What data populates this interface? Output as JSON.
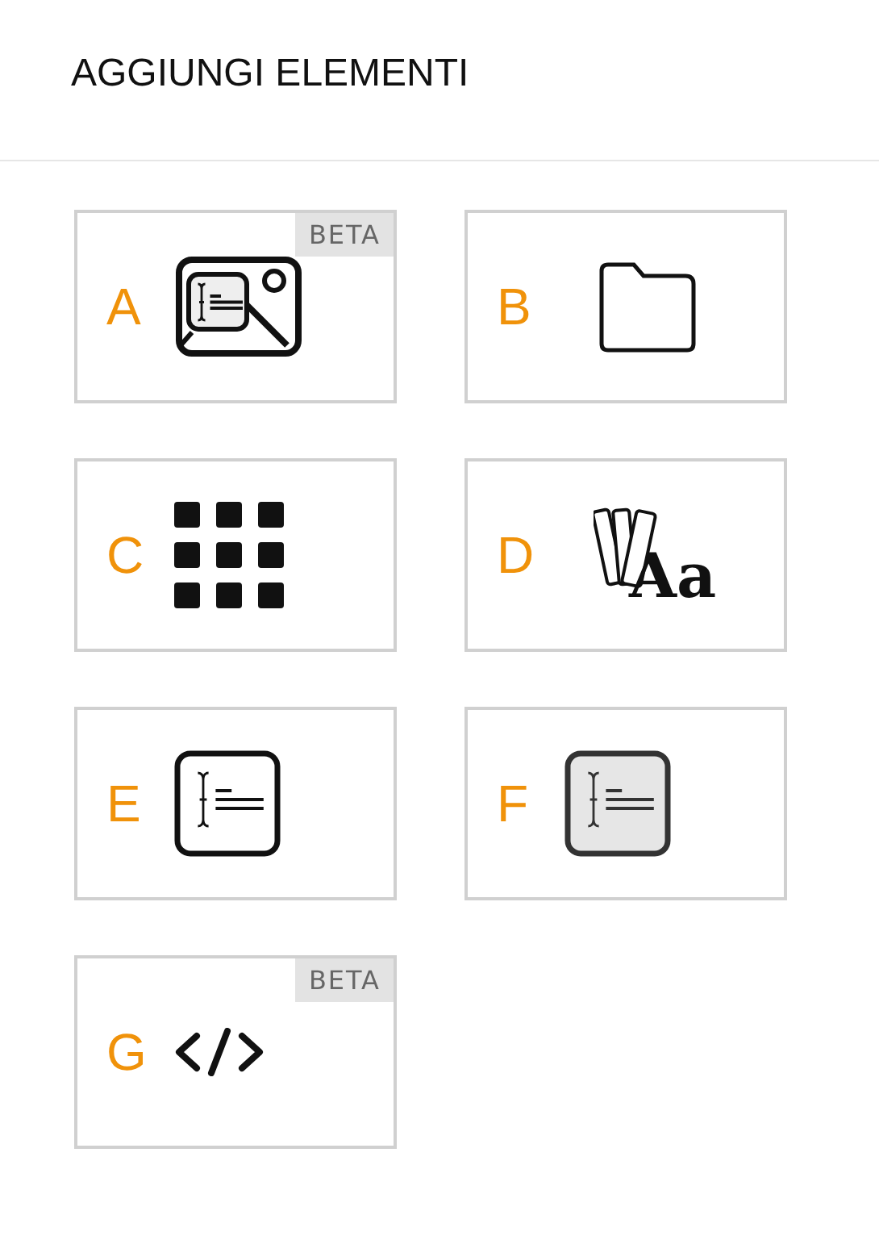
{
  "header": {
    "title": "AGGIUNGI ELEMENTI"
  },
  "items": [
    {
      "letter": "A",
      "kind": "image-text",
      "badge": "BETA"
    },
    {
      "letter": "B",
      "kind": "folder"
    },
    {
      "letter": "C",
      "kind": "grid"
    },
    {
      "letter": "D",
      "kind": "swatch-font",
      "icon_text": "Aa"
    },
    {
      "letter": "E",
      "kind": "text-box"
    },
    {
      "letter": "F",
      "kind": "text-box-filled"
    },
    {
      "letter": "G",
      "kind": "code",
      "badge": "BETA"
    }
  ]
}
